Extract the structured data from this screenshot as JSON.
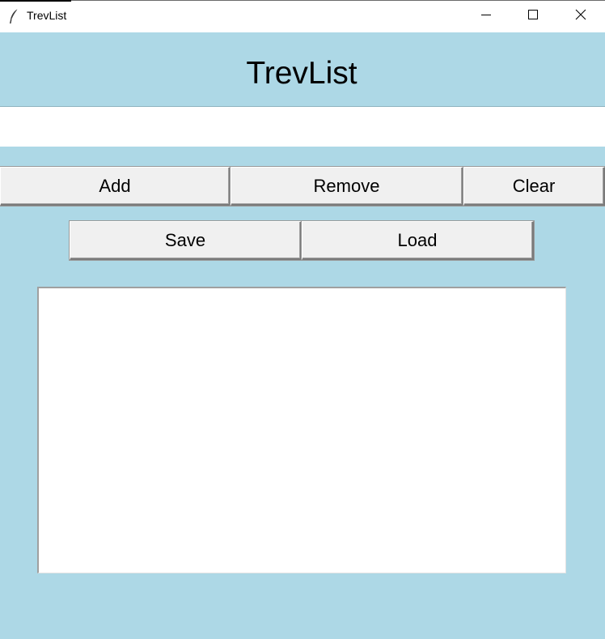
{
  "window": {
    "title": "TrevList",
    "controls": {
      "minimize": "minimize-icon",
      "maximize": "maximize-icon",
      "close": "close-icon"
    }
  },
  "header": {
    "title": "TrevList"
  },
  "entry": {
    "value": ""
  },
  "buttons": {
    "add": "Add",
    "remove": "Remove",
    "clear": "Clear",
    "save": "Save",
    "load": "Load"
  },
  "listbox": {
    "items": []
  },
  "colors": {
    "background": "#add8e6",
    "button": "#f0f0f0",
    "field": "#ffffff"
  }
}
